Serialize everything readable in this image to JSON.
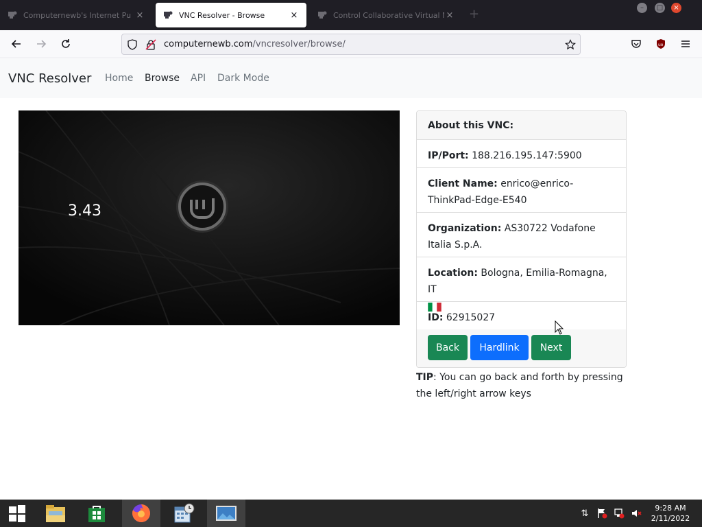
{
  "browser": {
    "tabs": [
      {
        "title": "Computernewb's Internet Pu",
        "close": "×"
      },
      {
        "title": "VNC Resolver - Browse",
        "close": "×"
      },
      {
        "title": "Control Collaborative Virtual M",
        "close": "×"
      }
    ],
    "new_tab": "+",
    "url": {
      "domain": "computernewb.com",
      "path": "/vncresolver/browse/"
    }
  },
  "site": {
    "brand": "VNC Resolver",
    "nav": [
      "Home",
      "Browse",
      "API",
      "Dark Mode"
    ]
  },
  "vnc": {
    "screen_text": "3.43"
  },
  "card": {
    "header": "About this VNC:",
    "ip_label": "IP/Port:",
    "ip_value": " 188.216.195.147:5900",
    "client_label": "Client Name:",
    "client_value": " enrico@enrico-ThinkPad-Edge-E540",
    "org_label": "Organization:",
    "org_value": " AS30722 Vodafone Italia S.p.A.",
    "loc_label": "Location:",
    "loc_value": " Bologna, Emilia-Romagna, IT",
    "id_label": "ID:",
    "id_value": " 62915027",
    "buttons": {
      "back": "Back",
      "hardlink": "Hardlink",
      "next": "Next"
    }
  },
  "tip": {
    "label": "TIP",
    "text": ": You can go back and forth by pressing the left/right arrow keys"
  },
  "taskbar": {
    "time": "9:28 AM",
    "date": "2/11/2022"
  },
  "colors": {
    "success": "#198754",
    "primary": "#0d6efd",
    "tab_bar": "#1f1e25",
    "taskbar": "#262626"
  },
  "icons": [
    "favicon-icon",
    "back-arrow-icon",
    "forward-arrow-icon",
    "reload-icon",
    "shield-icon",
    "lock-warning-icon",
    "star-icon",
    "pocket-icon",
    "ublock-icon",
    "menu-icon",
    "windows-start-icon",
    "file-explorer-icon",
    "store-icon",
    "firefox-icon",
    "calendar-icon",
    "image-viewer-icon",
    "network-icon",
    "flag-icon",
    "tray-network-icon",
    "volume-muted-icon",
    "italy-flag-icon"
  ]
}
